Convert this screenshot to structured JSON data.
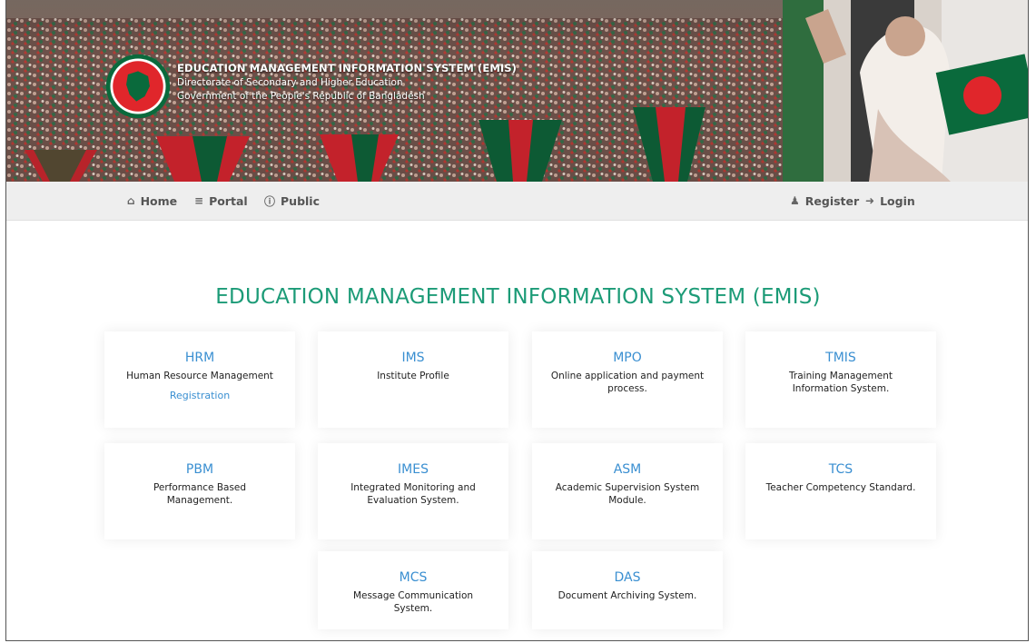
{
  "header": {
    "title": "EDUCATION MANAGEMENT INFORMATION SYSTEM (EMIS)",
    "subtitle1": "Directorate of Secondary and Higher Education",
    "subtitle2": "Government of the People's Republic of Bangladesh"
  },
  "nav": {
    "home": "Home",
    "portal": "Portal",
    "public": "Public",
    "register": "Register",
    "login": "Login"
  },
  "main": {
    "title": "EDUCATION MANAGEMENT INFORMATION SYSTEM (EMIS)"
  },
  "modules": [
    {
      "abbr": "HRM",
      "desc": "Human Resource Management",
      "link": "Registration"
    },
    {
      "abbr": "IMS",
      "desc": "Institute Profile"
    },
    {
      "abbr": "MPO",
      "desc": "Online application and payment process."
    },
    {
      "abbr": "TMIS",
      "desc": "Training Management Information System."
    },
    {
      "abbr": "PBM",
      "desc": "Performance Based Management."
    },
    {
      "abbr": "IMES",
      "desc": "Integrated Monitoring and Evaluation System."
    },
    {
      "abbr": "ASM",
      "desc": "Academic Supervision System Module."
    },
    {
      "abbr": "TCS",
      "desc": "Teacher Competency Standard."
    },
    {
      "abbr": "MCS",
      "desc": "Message Communication System."
    },
    {
      "abbr": "DAS",
      "desc": "Document Archiving System."
    }
  ],
  "icons": {
    "home": "home-icon",
    "portal": "bars-icon",
    "public": "info-circle-icon",
    "register": "user-icon",
    "login": "sign-in-icon"
  },
  "colors": {
    "accent_green": "#1c9b77",
    "link_blue": "#3a8fd1",
    "flag_green": "#0a6a3c",
    "flag_red": "#e0262b"
  }
}
